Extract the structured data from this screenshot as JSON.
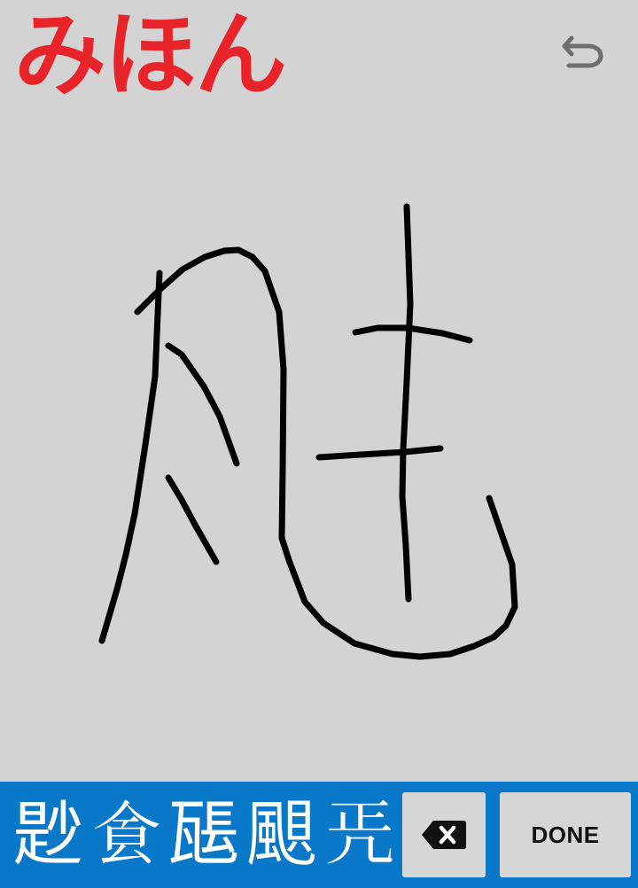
{
  "title": "みほん",
  "colors": {
    "title": "#e8242b",
    "background": "#d3d3d3",
    "bar": "#0a78c8",
    "key": "#d6d6d6",
    "ink": "#000000"
  },
  "toolbar": {
    "undo_icon": "undo-icon"
  },
  "candidates": [
    "尟",
    "𩚀",
    "𤭖",
    "𩗗",
    "𠙁"
  ],
  "keys": {
    "backspace_icon": "backspace-icon",
    "done_label": "DONE"
  }
}
